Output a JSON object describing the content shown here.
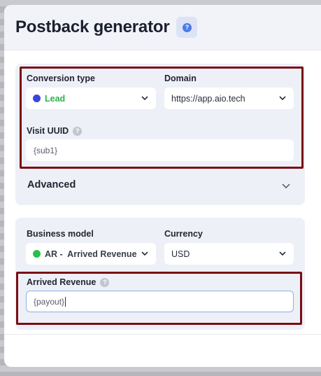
{
  "modal": {
    "title": "Postback generator",
    "help_glyph": "?"
  },
  "conversion": {
    "conversion_type": {
      "label": "Conversion type",
      "value": "Lead",
      "status_color": "#3b44e0",
      "value_color": "#2bb24c"
    },
    "domain": {
      "label": "Domain",
      "value": "https://app.aio.tech"
    },
    "visit_uuid": {
      "label": "Visit UUID",
      "value": "{sub1}"
    },
    "advanced_label": "Advanced"
  },
  "revenue": {
    "business_model": {
      "label": "Business model",
      "value": "AR -  Arrived Revenue",
      "status_color": "#27c04a"
    },
    "currency": {
      "label": "Currency",
      "value": "USD"
    },
    "arrived_revenue": {
      "label": "Arrived Revenue",
      "value": "{payout}"
    }
  },
  "icons": [
    "help-icon",
    "chevron-down-icon",
    "question-icon"
  ],
  "colors": {
    "highlight": "#7a0d13",
    "card_bg": "#eef0f8",
    "accent": "#4b7be8"
  }
}
